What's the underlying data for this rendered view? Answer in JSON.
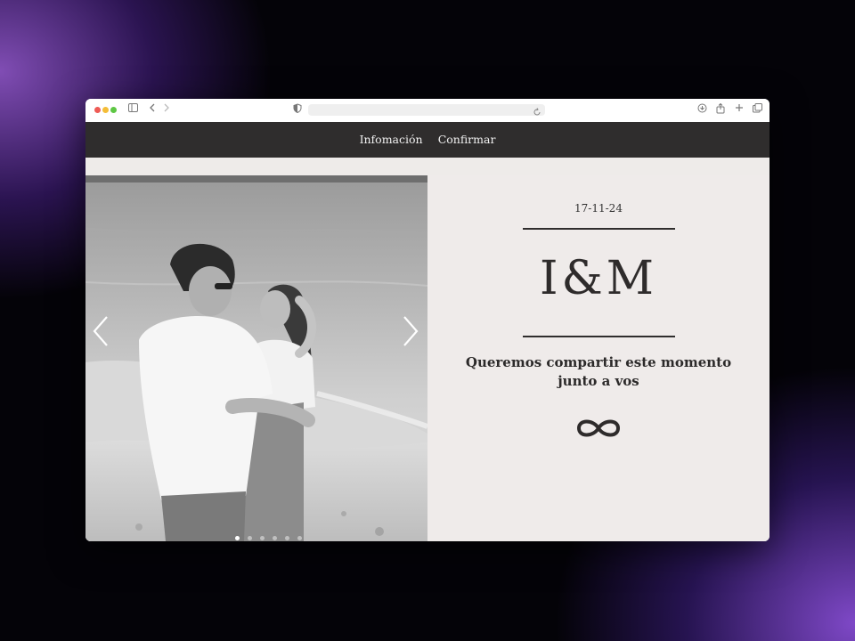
{
  "nav": {
    "items": [
      {
        "label": "Infomación"
      },
      {
        "label": "Confirmar"
      }
    ]
  },
  "invitation": {
    "date": "17-11-24",
    "monogram": "I&M",
    "message_line1": "Queremos compartir este momento",
    "message_line2": "junto a vos"
  },
  "icons": {
    "symbol": "infinity-icon",
    "prev": "chevron-left-icon",
    "next": "chevron-right-icon"
  },
  "carousel": {
    "slides": 6,
    "active_slide": 1
  },
  "colors": {
    "nav_bg": "#2f2d2d",
    "panel_bg": "#efebea",
    "text": "#2e2b2b"
  }
}
